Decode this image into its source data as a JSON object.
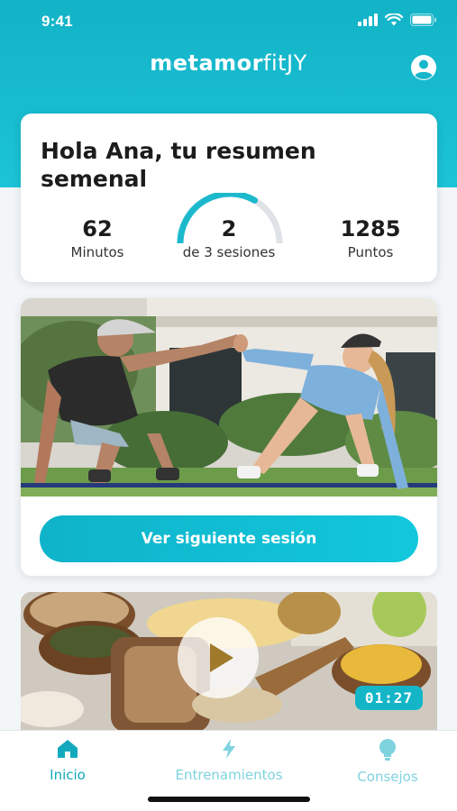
{
  "status_bar": {
    "time": "9:41"
  },
  "header": {
    "logo_bold": "metamor",
    "logo_light": "fitJY"
  },
  "summary": {
    "title": "Hola Ana, tu resumen semenal",
    "minutes": {
      "value": "62",
      "label": "Minutos"
    },
    "sessions": {
      "value": "2",
      "label": "de 3 sesiones",
      "completed": 2,
      "total": 3
    },
    "points": {
      "value": "1285",
      "label": "Puntos"
    }
  },
  "workout": {
    "button_label": "Ver siguiente sesión"
  },
  "video": {
    "duration": "01:27"
  },
  "tabs": [
    {
      "label": "Inicio",
      "icon": "home-icon",
      "active": true
    },
    {
      "label": "Entrenamientos",
      "icon": "lightning-icon",
      "active": false
    },
    {
      "label": "Consejos",
      "icon": "lightbulb-icon",
      "active": false
    }
  ],
  "colors": {
    "accent": "#13b3c7",
    "tab_active": "#13a9bd",
    "tab_inactive": "#7fd3df"
  }
}
